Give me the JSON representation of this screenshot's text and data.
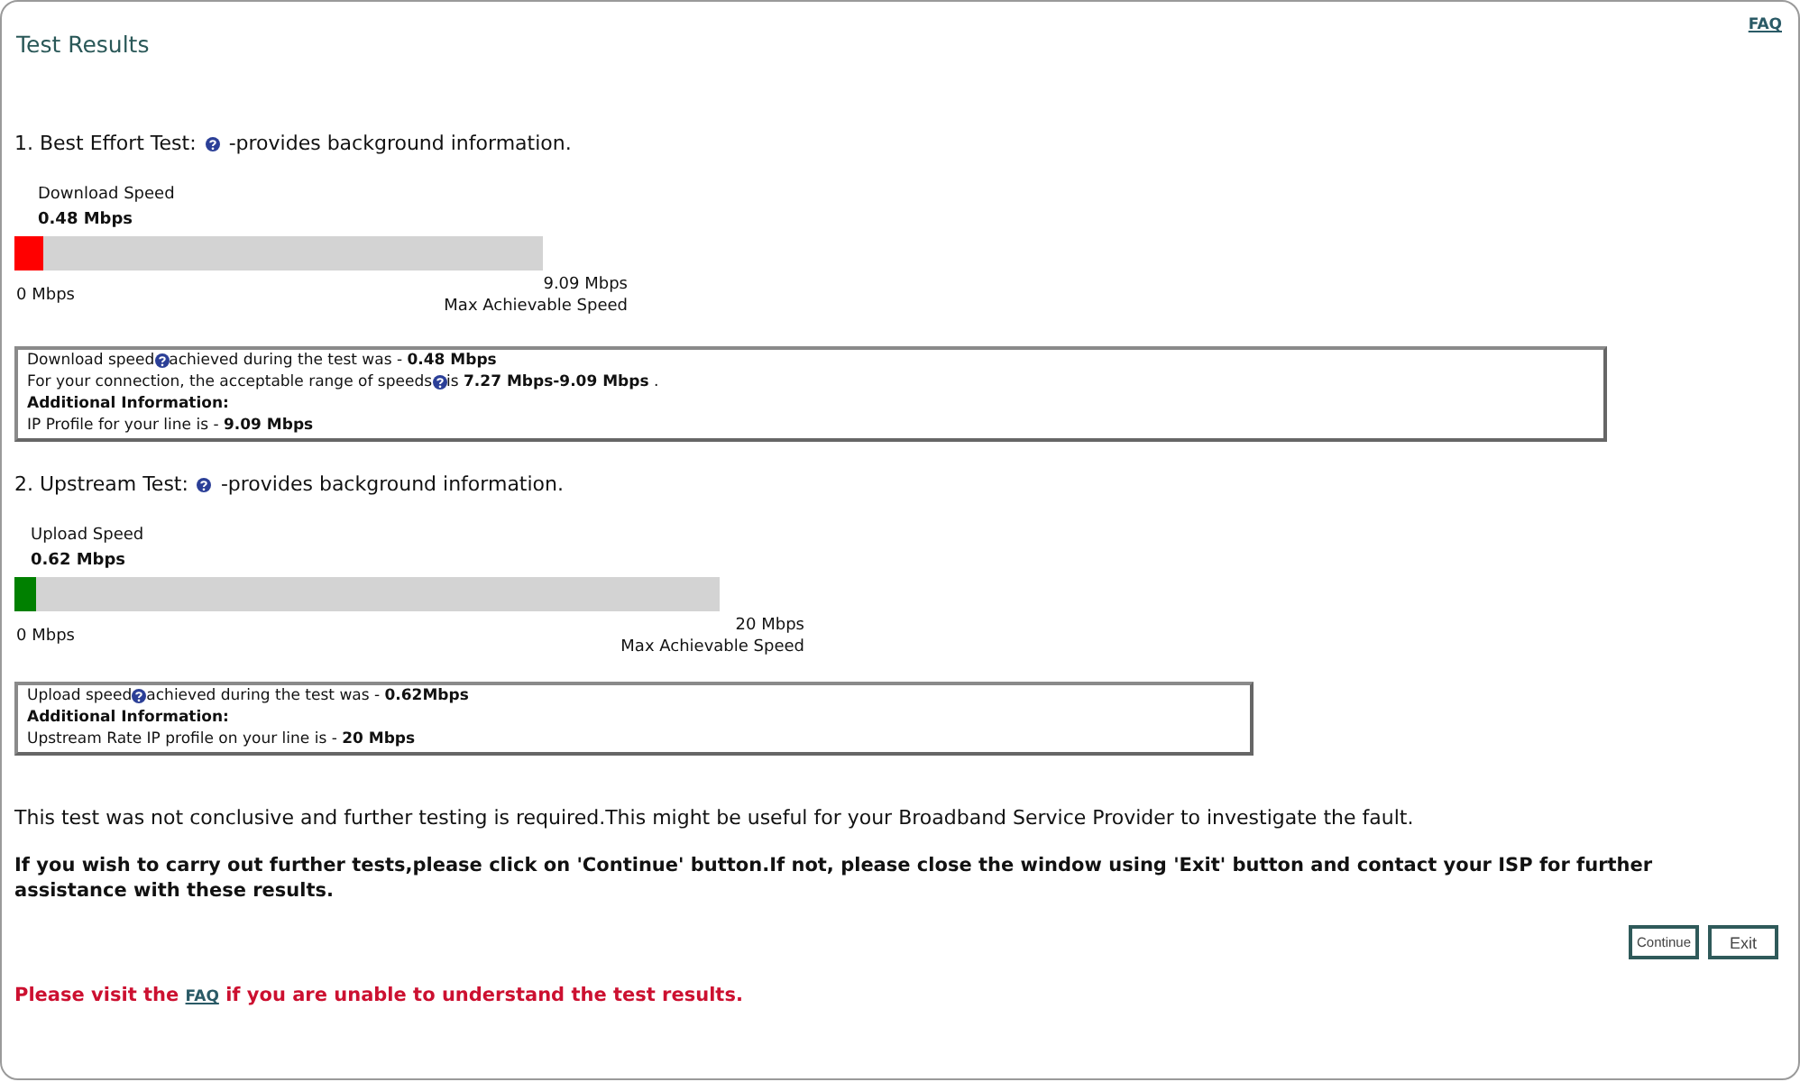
{
  "header": {
    "title": "Test Results",
    "faq_link": "FAQ"
  },
  "tests": [
    {
      "title": "1. Best Effort Test:",
      "description": "-provides background information.",
      "meter": {
        "label": "Download Speed",
        "reading": "0.48 Mbps",
        "level": 0.053,
        "color": "#ff0000",
        "min_label": "0 Mbps",
        "max_label": "9.09 Mbps",
        "max_caption": "Max Achievable Speed"
      },
      "details": [
        {
          "kind": "help",
          "text": "Download speed",
          "after": "achieved during the test was - **0.48 Mbps**"
        },
        {
          "kind": "help",
          "text": "For your connection, the acceptable range of speeds",
          "after": "is **7.27 Mbps-9.09 Mbps** ."
        },
        {
          "kind": "heading",
          "text": "Additional Information:"
        },
        {
          "kind": "text",
          "text": "IP Profile for your line is - **9.09 Mbps**"
        }
      ]
    },
    {
      "title": "2. Upstream Test:",
      "description": "-provides background information.",
      "meter": {
        "label": "Upload Speed",
        "reading": "0.62 Mbps",
        "level": 0.031,
        "color": "#008000",
        "min_label": "0 Mbps",
        "max_label": "20 Mbps",
        "max_caption": "Max Achievable Speed"
      },
      "details": [
        {
          "kind": "help",
          "text": "Upload speed",
          "after": " achieved during the test was - **0.62Mbps**"
        },
        {
          "kind": "heading",
          "text": "Additional Information:"
        },
        {
          "kind": "text",
          "text": "Upstream Rate IP profile on your line is - **20 Mbps**"
        }
      ]
    }
  ],
  "note": "This test was not conclusive and further testing is required.This might be useful for your Broadband Service Provider to investigate the fault.",
  "instruction": "If you wish to carry out further tests,please click on 'Continue' button.If not, please close the window using 'Exit' button and contact your ISP for further assistance with these results.",
  "buttons": [
    {
      "label": "Continue"
    },
    {
      "label": "Exit"
    }
  ],
  "faq_notice": {
    "before": "Please visit the",
    "link": "FAQ",
    "after": "if you are unable to understand the test results."
  }
}
